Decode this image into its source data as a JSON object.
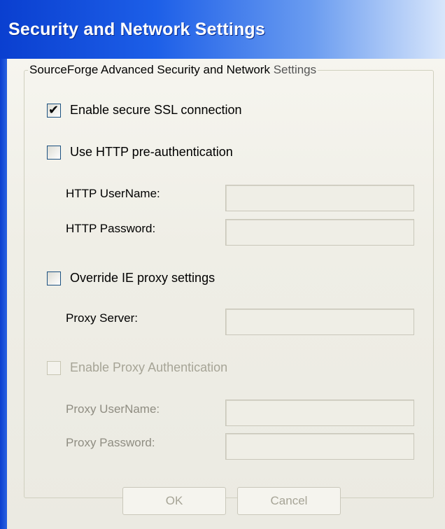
{
  "window": {
    "title": "Security and Network Settings"
  },
  "group": {
    "legend_main": "SourceForge Advanced Security and Network",
    "legend_tail": "Settings"
  },
  "options": {
    "ssl": {
      "label": "Enable secure SSL connection",
      "checked": true
    },
    "http_preauth": {
      "label": "Use HTTP pre-authentication",
      "checked": false
    },
    "override_proxy": {
      "label": "Override IE proxy settings",
      "checked": false
    },
    "proxy_auth": {
      "label": "Enable Proxy Authentication",
      "checked": false,
      "disabled": true
    }
  },
  "fields": {
    "http_username": {
      "label": "HTTP UserName:",
      "value": ""
    },
    "http_password": {
      "label": "HTTP Password:",
      "value": ""
    },
    "proxy_server": {
      "label": "Proxy Server:",
      "value": ""
    },
    "proxy_username": {
      "label": "Proxy UserName:",
      "value": ""
    },
    "proxy_password": {
      "label": "Proxy Password:",
      "value": ""
    }
  },
  "buttons": {
    "ok": "OK",
    "cancel": "Cancel"
  },
  "colors": {
    "titlebar_start": "#0a3fd0",
    "titlebar_end": "#d8e6fb",
    "check_green": "#21a121",
    "disabled_text": "#a6a496"
  }
}
